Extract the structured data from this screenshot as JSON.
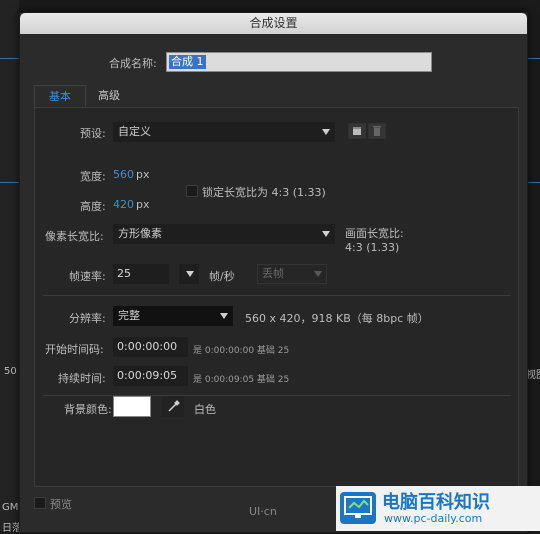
{
  "dialog": {
    "title": "合成设置"
  },
  "name": {
    "label": "合成名称:",
    "value": "合成 1"
  },
  "tabs": [
    {
      "label": "基本"
    },
    {
      "label": "高级"
    }
  ],
  "preset": {
    "label": "预设:",
    "value": "自定义"
  },
  "width": {
    "label": "宽度:",
    "value": "560",
    "unit": "px"
  },
  "height": {
    "label": "高度:",
    "value": "420",
    "unit": "px"
  },
  "lock_aspect": {
    "label": "锁定长宽比为 4:3 (1.33)",
    "checked": false
  },
  "pixel_aspect": {
    "label": "像素长宽比:",
    "value": "方形像素"
  },
  "frame_aspect": {
    "label": "画面长宽比:",
    "value": "4:3 (1.33)"
  },
  "frame_rate": {
    "label": "帧速率:",
    "value": "25",
    "unit": "帧/秒",
    "drop_frame": "丢帧"
  },
  "resolution": {
    "label": "分辨率:",
    "value": "完整",
    "info": "560 x 420，918 KB（每 8bpc 帧）"
  },
  "start_timecode": {
    "label": "开始时间码:",
    "value": "0:00:00:00",
    "info": "是 0:00:00:00  基础 25"
  },
  "duration": {
    "label": "持续时间:",
    "value": "0:00:09:05",
    "info": "是 0:00:09:05  基础 25"
  },
  "background": {
    "label": "背景颜色:",
    "color_name": "白色",
    "color": "#ffffff"
  },
  "preview": {
    "label": "预览"
  },
  "background_app": {
    "left_text_1": "50",
    "left_text_2": "GM",
    "left_text_3": "日落",
    "right_text": "视图"
  },
  "watermark": {
    "small_logo": "UI·cn",
    "title": "电脑百科知识",
    "url": "www.pc-daily.com"
  },
  "colors": {
    "accent": "#3d8fd8",
    "dialog_bg": "#2b2b2b",
    "panel_bg": "#262626"
  }
}
